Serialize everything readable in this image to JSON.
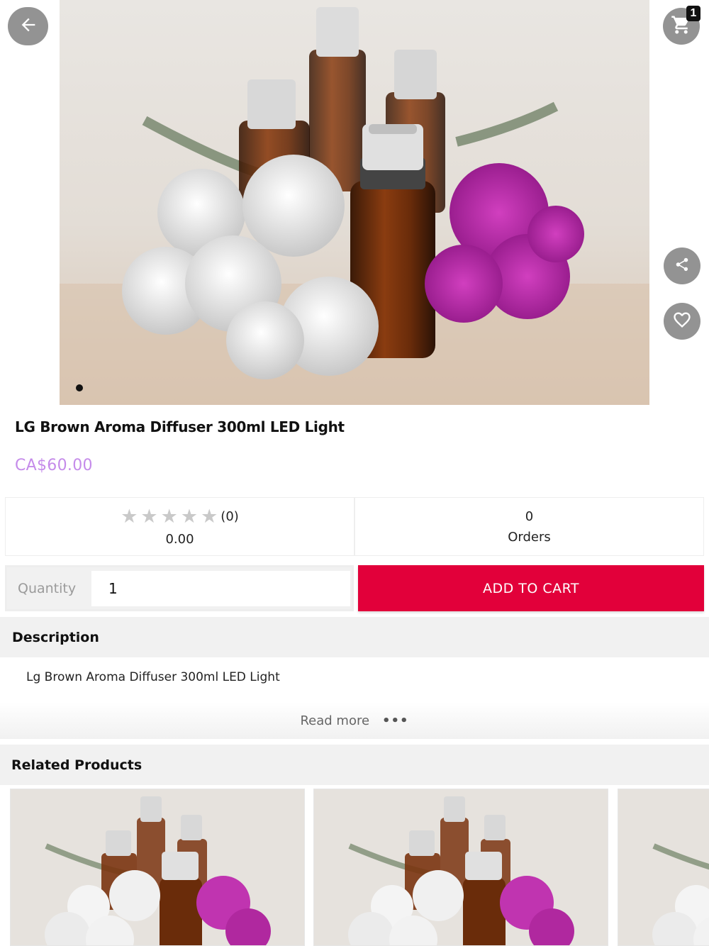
{
  "header": {
    "back_icon": "arrow-left-icon",
    "cart_icon": "shopping-cart-icon",
    "cart_count": "1",
    "share_icon": "share-icon",
    "favorite_icon": "heart-icon"
  },
  "product": {
    "title": "LG Brown Aroma Diffuser 300ml LED Light",
    "price": "CA$60.00",
    "rating": {
      "stars_filled": 0,
      "stars_total": 5,
      "count": "(0)",
      "value": "0.00"
    },
    "orders": {
      "count": "0",
      "label": "Orders"
    },
    "image_carousel": {
      "dots": 1,
      "active": 1
    }
  },
  "purchase": {
    "quantity_label": "Quantity",
    "quantity_value": "1",
    "add_to_cart_label": "ADD TO CART"
  },
  "description": {
    "heading": "Description",
    "text": "Lg Brown Aroma Diffuser 300ml LED Light",
    "read_more_label": "Read more",
    "more_icon": "ellipsis-icon"
  },
  "related": {
    "heading": "Related Products",
    "items_visible": 3
  },
  "colors": {
    "price": "#c58bea",
    "add_to_cart": "#e2003a",
    "section_bg": "#f1f1f1",
    "round_button": "#808080"
  }
}
